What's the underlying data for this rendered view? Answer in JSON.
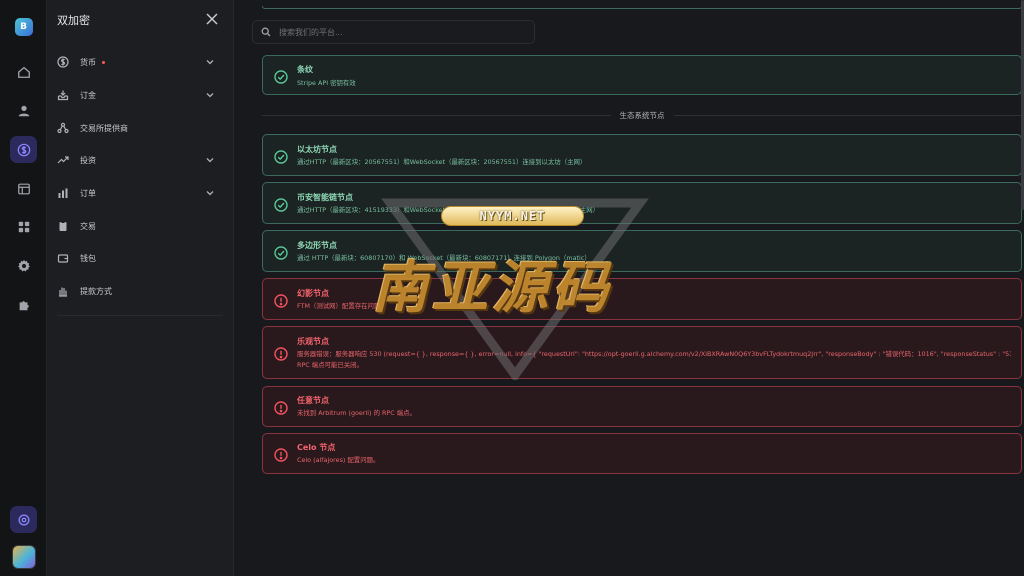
{
  "app": {
    "logo_letter": "B",
    "panel_title": "双加密"
  },
  "rail": {
    "icons": [
      "logo-icon",
      "dashboard-icon",
      "user-icon",
      "dollar-icon",
      "table-icon",
      "apps-icon",
      "gear-icon",
      "puzzle-icon",
      "settings-badge-icon",
      "avatar"
    ]
  },
  "sidebar": {
    "items": [
      {
        "label": "货币",
        "icon": "coin-icon",
        "expandable": true,
        "badge": true
      },
      {
        "label": "订金",
        "icon": "inbox-icon",
        "expandable": true
      },
      {
        "label": "交易所提供商",
        "icon": "nodes-icon",
        "expandable": false
      },
      {
        "label": "投资",
        "icon": "trend-icon",
        "expandable": true
      },
      {
        "label": "订单",
        "icon": "bar-chart-icon",
        "expandable": true
      },
      {
        "label": "交易",
        "icon": "clipboard-icon",
        "expandable": false
      },
      {
        "label": "钱包",
        "icon": "wallet-icon",
        "expandable": false
      },
      {
        "label": "提款方式",
        "icon": "hand-icon",
        "expandable": false
      }
    ]
  },
  "search": {
    "placeholder": "搜索我们的平台..."
  },
  "cards_top": [
    {
      "status": "ok",
      "title": "条纹",
      "description": "Stripe API 密钥有效"
    }
  ],
  "section": {
    "label": "生态系统节点"
  },
  "cards": [
    {
      "status": "ok",
      "title": "以太坊节点",
      "description": "通过HTTP（最新区块：20567551）和WebSocket（最新区块：20567551）连接到以太坊（主网）"
    },
    {
      "status": "ok",
      "title": "币安智能链节点",
      "description": "通过HTTP（最新区块：41519333）和WebSocket（最新区块：41519333）连接到币安智能链（主网）"
    },
    {
      "status": "ok",
      "title": "多边形节点",
      "description": "通过 HTTP（最新块：60807170）和 WebSocket（最新块：60807171）连接到 Polygon（matic）"
    },
    {
      "status": "err",
      "title": "幻影节点",
      "description": "FTM（测试网）配置存在问题。"
    },
    {
      "status": "err",
      "title": "乐观节点",
      "description": "服务器错误：服务器响应 530 (request={ }, response={ }, error=null, info={ \"requestUrl\": \"https://opt-goerli.g.alchemy.com/v2/XiBXRAwN0Q6Y3bvFLTydokrtmuq2Jrr\", \"responseBody\" : \"错误代码：1016\", \"responseStatus\" : \"530\" }",
      "description2": "RPC 端点可能已关闭。"
    },
    {
      "status": "err",
      "title": "任意节点",
      "description": "未找到 Arbitrum (goerli) 的 RPC 端点。"
    },
    {
      "status": "err",
      "title": "Celo 节点",
      "description": "Celo (alfajores) 配置问题。"
    }
  ],
  "watermark": {
    "pill": "NYYM.NET",
    "text": "南亚源码"
  },
  "colors": {
    "ok_border": "#3a6a5c",
    "ok_text": "#8ed8b6",
    "err_border": "#8a3340",
    "err_text": "#f3646e",
    "accent": "#8b86ff"
  }
}
